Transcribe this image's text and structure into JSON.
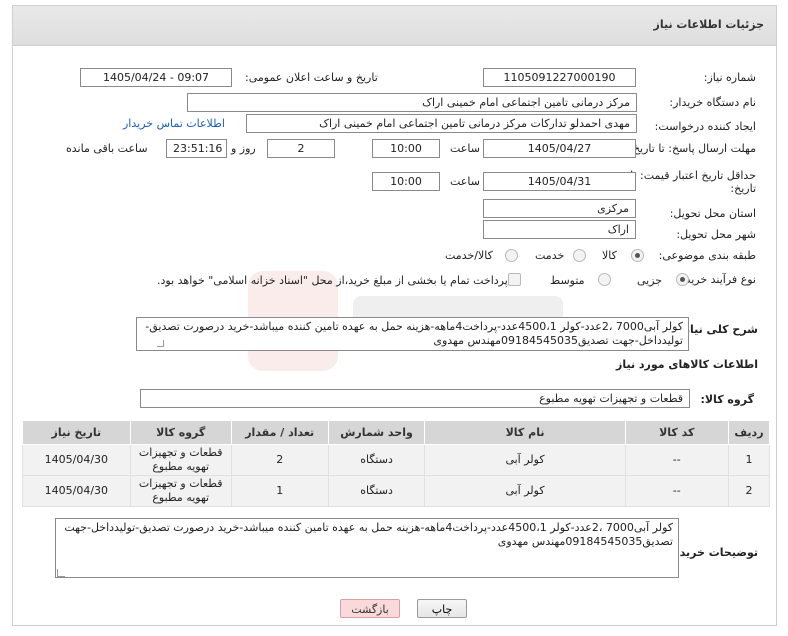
{
  "header": {
    "title": "جزئیات اطلاعات نیاز"
  },
  "fields": {
    "need_number": {
      "label": "شماره نیاز:",
      "value": "1105091227000190"
    },
    "announce_datetime": {
      "label": "تاریخ و ساعت اعلان عمومی:",
      "value": "1405/04/24 - 09:07"
    },
    "buyer_org": {
      "label": "نام دستگاه خریدار:",
      "value": "مرکز درمانی تامین اجتماعی امام خمینی اراک"
    },
    "requester": {
      "label": "ایجاد کننده درخواست:",
      "value": "مهدی احمدلو تدارکات مرکز درمانی تامین اجتماعی امام خمینی اراک",
      "contact_link": "اطلاعات تماس خریدار"
    },
    "reply_deadline": {
      "label": "مهلت ارسال پاسخ: تا تاریخ:",
      "date": "1405/04/27",
      "time_label": "ساعت",
      "time": "10:00",
      "days": "2",
      "days_label": "روز و",
      "remaining": "23:51:16",
      "remaining_label": "ساعت باقی مانده"
    },
    "price_validity": {
      "label": "حداقل تاریخ اعتبار قیمت: تا تاریخ:",
      "date": "1405/04/31",
      "time_label": "ساعت",
      "time": "10:00"
    },
    "delivery_province": {
      "label": "استان محل تحویل:",
      "value": "مرکزی"
    },
    "delivery_city": {
      "label": "شهر محل تحویل:",
      "value": "اراک"
    },
    "category": {
      "label": "طبقه بندی موضوعی:",
      "options": [
        "کالا",
        "خدمت",
        "کالا/خدمت"
      ],
      "selected": "کالا"
    },
    "process_type": {
      "label": "نوع فرآیند خرید :",
      "options": [
        "جزیی",
        "متوسط"
      ],
      "selected": "جزیی",
      "payment_note": "پرداخت تمام یا بخشی از مبلغ خرید،از محل \"اسناد خزانه اسلامی\" خواهد بود."
    }
  },
  "general_desc": {
    "label": "شرح کلی نیاز:",
    "text": "کولر آبی7000 ،2عدد-کولر 4500،1عدد-پرداخت4ماهه-هزینه حمل به عهده تامین کننده میباشد-خرید درصورت تصدیق-تولیدداخل-جهت تصدیق09184545035مهندس مهدوی"
  },
  "goods_section": {
    "title": "اطلاعات کالاهای مورد نیاز",
    "group_label": "گروه کالا:",
    "group_value": "قطعات و تجهیزات تهویه مطبوع"
  },
  "table": {
    "headers": [
      "ردیف",
      "کد کالا",
      "نام کالا",
      "واحد شمارش",
      "تعداد / مقدار",
      "گروه کالا",
      "تاریخ نیاز"
    ],
    "rows": [
      [
        "1",
        "--",
        "کولر آبی",
        "دستگاه",
        "2",
        "قطعات و تجهیزات تهویه مطبوع",
        "1405/04/30"
      ],
      [
        "2",
        "--",
        "کولر آبی",
        "دستگاه",
        "1",
        "قطعات و تجهیزات تهویه مطبوع",
        "1405/04/30"
      ]
    ]
  },
  "buyer_notes": {
    "label": "توضیحات خریدار:",
    "text": "کولر آبی7000 ،2عدد-کولر 4500،1عدد-پرداخت4ماهه-هزینه حمل به عهده تامین کننده میباشد-خرید درصورت تصدیق-تولیدداخل-جهت تصدیق09184545035مهندس مهدوی"
  },
  "buttons": {
    "print": "چاپ",
    "back": "بازگشت"
  },
  "colors": {
    "link": "#1a5fb4",
    "header_bg": "#e3e3e3",
    "back_button": "#f9d9d9",
    "table_header": "#d6d6d6"
  }
}
